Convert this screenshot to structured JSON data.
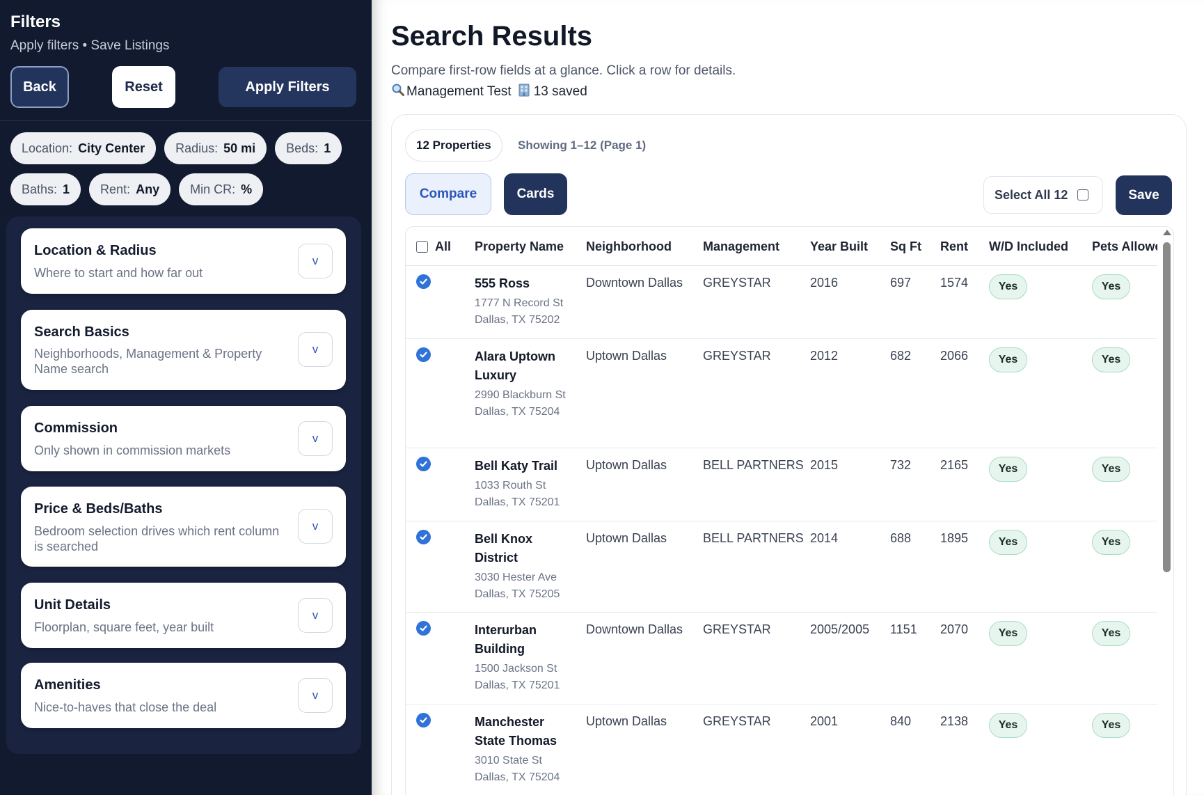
{
  "sidebar": {
    "title": "Filters",
    "subtitle": "Apply filters • Save Listings",
    "back_label": "Back",
    "reset_label": "Reset",
    "apply_label": "Apply Filters",
    "chips": [
      {
        "label": "Location:",
        "value": "City Center"
      },
      {
        "label": "Radius:",
        "value": "50 mi"
      },
      {
        "label": "Beds:",
        "value": "1"
      },
      {
        "label": "Baths:",
        "value": "1"
      },
      {
        "label": "Rent:",
        "value": "Any"
      },
      {
        "label": "Min CR:",
        "value": "%"
      }
    ],
    "sections": [
      {
        "title": "Location & Radius",
        "desc": "Where to start and how far out"
      },
      {
        "title": "Search Basics",
        "desc": "Neighborhoods, Management & Property Name search"
      },
      {
        "title": "Commission",
        "desc": "Only shown in commission markets"
      },
      {
        "title": "Price & Beds/Baths",
        "desc": "Bedroom selection drives which rent column is searched"
      },
      {
        "title": "Unit Details",
        "desc": "Floorplan, square feet, year built"
      },
      {
        "title": "Amenities",
        "desc": "Nice-to-haves that close the deal"
      }
    ],
    "expand_glyph": "v"
  },
  "main": {
    "title": "Search Results",
    "subtitle": "Compare first-row fields at a glance. Click a row for details.",
    "search_name": "Management Test",
    "saved_count": "13 saved",
    "count_label": "12 Properties",
    "showing_label": "Showing 1–12 (Page 1)",
    "compare_label": "Compare",
    "cards_label": "Cards",
    "select_all_label": "Select All 12",
    "save_label": "Save"
  },
  "table": {
    "columns": [
      "All",
      "Property Name",
      "Neighborhood",
      "Management",
      "Year Built",
      "Sq Ft",
      "Rent",
      "W/D Included",
      "Pets Allowed"
    ],
    "rows": [
      {
        "name": "555 Ross",
        "address": "1777 N Record St Dallas, TX 75202",
        "neighborhood": "Downtown Dallas",
        "management": "GREYSTAR",
        "year": "2016",
        "sqft": "697",
        "rent": "1574",
        "wd": "Yes",
        "pets": "Yes"
      },
      {
        "name": "Alara Uptown Luxury",
        "address": "2990 Blackburn St Dallas, TX 75204",
        "neighborhood": "Uptown Dallas",
        "management": "GREYSTAR",
        "year": "2012",
        "sqft": "682",
        "rent": "2066",
        "wd": "Yes",
        "pets": "Yes"
      },
      {
        "name": "Bell Katy Trail",
        "address": "1033 Routh St Dallas, TX 75201",
        "neighborhood": "Uptown Dallas",
        "management": "BELL PARTNERS",
        "year": "2015",
        "sqft": "732",
        "rent": "2165",
        "wd": "Yes",
        "pets": "Yes"
      },
      {
        "name": "Bell Knox District",
        "address": "3030 Hester Ave Dallas, TX 75205",
        "neighborhood": "Uptown Dallas",
        "management": "BELL PARTNERS",
        "year": "2014",
        "sqft": "688",
        "rent": "1895",
        "wd": "Yes",
        "pets": "Yes"
      },
      {
        "name": "Interurban Building",
        "address": "1500 Jackson St Dallas, TX 75201",
        "neighborhood": "Downtown Dallas",
        "management": "GREYSTAR",
        "year": "2005/2005",
        "sqft": "1151",
        "rent": "2070",
        "wd": "Yes",
        "pets": "Yes"
      },
      {
        "name": "Manchester State Thomas",
        "address": "3010 State St Dallas, TX 75204",
        "neighborhood": "Uptown Dallas",
        "management": "GREYSTAR",
        "year": "2001",
        "sqft": "840",
        "rent": "2138",
        "wd": "Yes",
        "pets": "Yes"
      }
    ]
  },
  "colors": {
    "sidebar_bg": "#121a30",
    "accent": "#2f73d9",
    "primary_button": "#23345c",
    "yes_badge": "#e6f6ee"
  },
  "icons": {
    "search": "magnifier-icon",
    "saved": "building-icon",
    "row_check": "check-circle-icon",
    "expand": "chevron-down-icon"
  }
}
